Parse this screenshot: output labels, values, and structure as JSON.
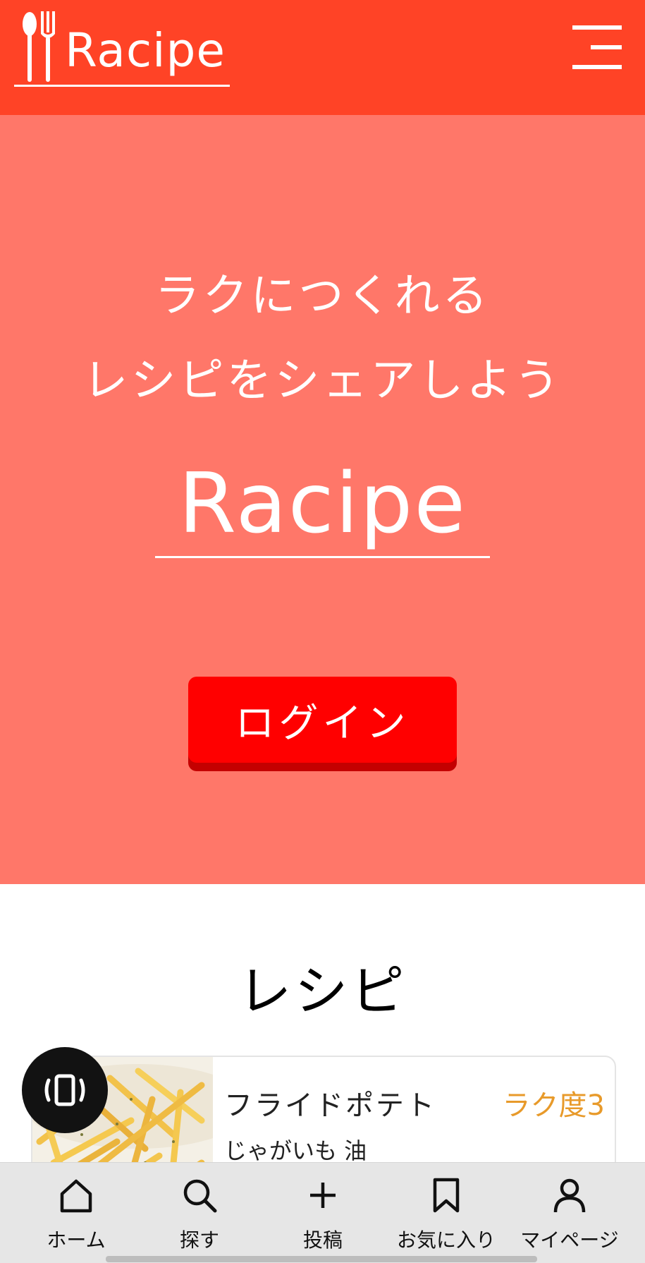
{
  "header": {
    "logo_text": "Racipe",
    "logo_icon": "spoon-fork-icon",
    "menu_icon": "hamburger-menu-icon",
    "background_color": "#ff4326"
  },
  "hero": {
    "line1": "ラクにつくれる",
    "line2": "レシピをシェアしよう",
    "brand": "Racipe",
    "login_label": "ログイン",
    "background_color": "#ff7769",
    "button_color": "#ff0000"
  },
  "recipes": {
    "title": "レシピ",
    "items": [
      {
        "name": "フライドポテト",
        "ease": "ラク度3",
        "ingredients": "じゃがいも 油",
        "image": "french-fries-photo"
      }
    ]
  },
  "floating_button": {
    "icon": "phone-vibrate-icon"
  },
  "bottom_nav": {
    "items": [
      {
        "label": "ホーム",
        "icon": "home-icon"
      },
      {
        "label": "探す",
        "icon": "search-icon"
      },
      {
        "label": "投稿",
        "icon": "plus-icon"
      },
      {
        "label": "お気に入り",
        "icon": "bookmark-icon"
      },
      {
        "label": "マイページ",
        "icon": "user-icon"
      }
    ]
  }
}
